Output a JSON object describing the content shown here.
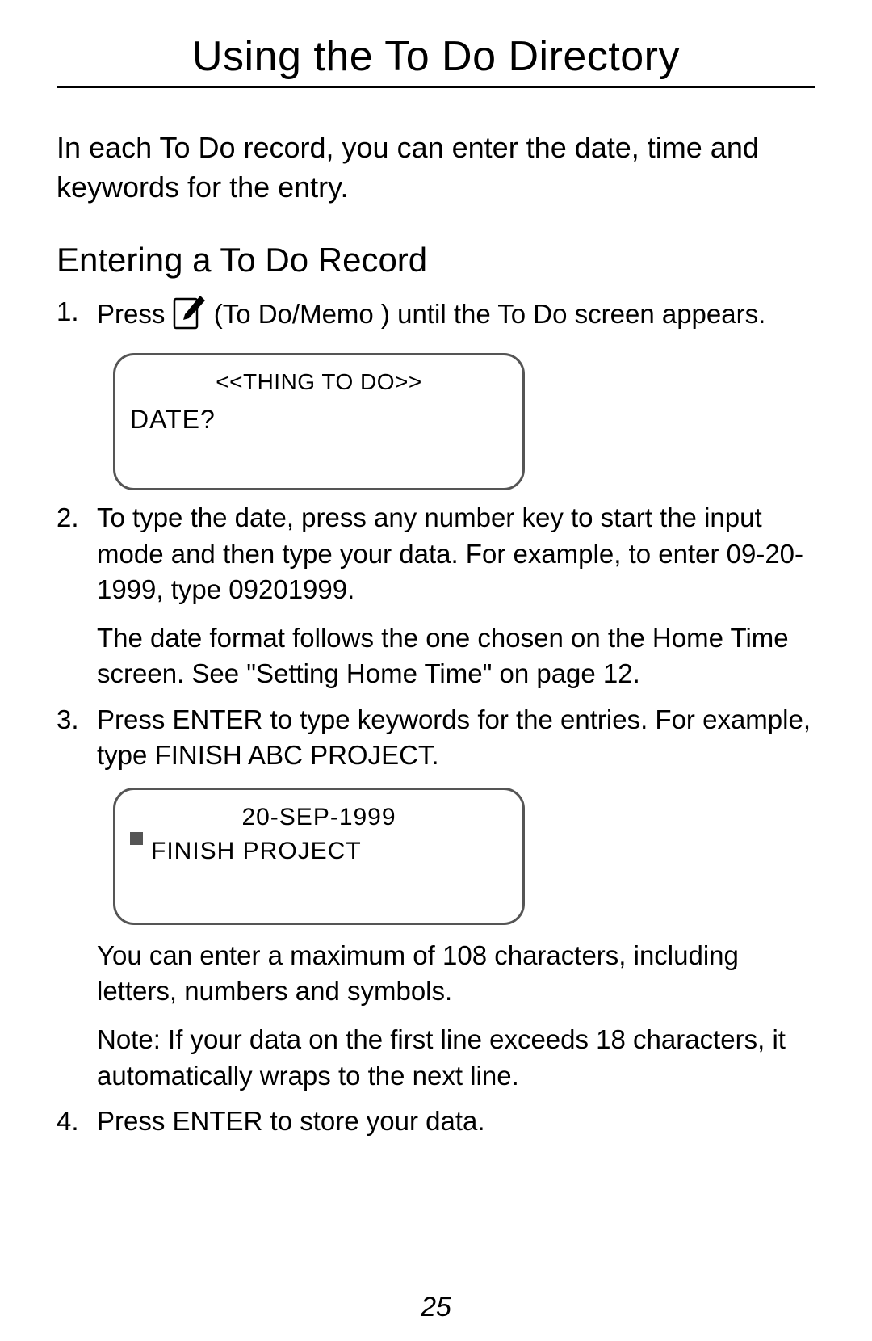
{
  "title": "Using the To Do Directory",
  "intro": "In each To Do record, you can enter the date, time and keywords for the entry.",
  "section": "Entering a To Do Record",
  "step1": {
    "pre": "Press ",
    "button_label": "To Do/Memo",
    "post": " until the To Do screen appears."
  },
  "lcd1": {
    "header": "<<THING TO DO>>",
    "line1": "DATE?"
  },
  "step2": {
    "text": "To type the date, press any number key to start the input mode and then type your data. For example, to enter 09-20-1999, type 09201999.",
    "note": "The date format follows the one chosen on the Home Time screen. See \"Setting Home Time\" on page 12."
  },
  "step3": {
    "text": "Press ENTER to type keywords for the entries. For example, type FINISH ABC PROJECT."
  },
  "lcd2": {
    "header": "20-SEP-1999",
    "line1": "FINISH PROJECT"
  },
  "step3_sub1": "You can enter a maximum of 108 characters, including letters, numbers and symbols.",
  "step3_sub2": "Note: If your data on the first line exceeds 18 characters, it automatically wraps to the next line.",
  "step4": "Press ENTER to store your data.",
  "page_number": "25"
}
